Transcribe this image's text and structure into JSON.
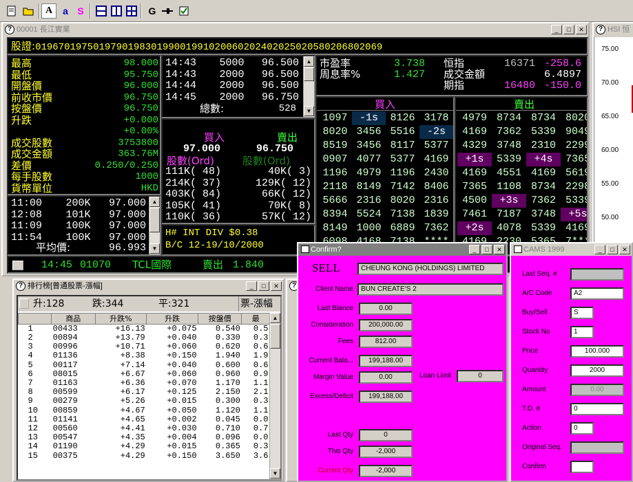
{
  "toolbar": {
    "buttons": [
      "new-icon",
      "open-icon",
      "A",
      "a",
      "S",
      "layout1-icon",
      "layout2-icon",
      "layout3-icon",
      "G",
      "pin-icon",
      "print-icon"
    ]
  },
  "quote_win": {
    "title": "00001 長江實業",
    "codes_label": "股證:",
    "codes": [
      "01967",
      "01975",
      "01979",
      "01983",
      "01990",
      "01991",
      "02006",
      "02024",
      "02025",
      "02058",
      "02068",
      "02069"
    ],
    "stats": [
      [
        "最高",
        "98.000"
      ],
      [
        "最低",
        "95.750"
      ],
      [
        "開盤價",
        "96.000"
      ],
      [
        "前收市價",
        "96.750"
      ],
      [
        "按盤價",
        "96.750"
      ],
      [
        "升跌",
        "+0.000"
      ],
      [
        "",
        "+0.00%"
      ],
      [
        "成交股數",
        "3753800"
      ],
      [
        "成交金額",
        "363.76M"
      ],
      [
        "差價",
        "0.250/0.250"
      ],
      [
        "每手股數",
        "1000"
      ],
      [
        "貨幣單位",
        "HKD"
      ]
    ],
    "ticks": [
      [
        "14:43",
        "5000",
        "96.500"
      ],
      [
        "14:43",
        "2000",
        "96.500"
      ],
      [
        "14:44",
        "2000",
        "96.500"
      ],
      [
        "14:45",
        "2000",
        "96.750"
      ]
    ],
    "total_label": "總數:",
    "total": "528",
    "bidask": {
      "bid_label": "買入",
      "ask_label": "賣出",
      "bid": "97.000",
      "ask": "96.750",
      "ord_bid_label": "股數(Ord)",
      "ord_ask_label": "股數(Ord)",
      "rows": [
        [
          "111K( 48)",
          "40K(  3)"
        ],
        [
          "214K( 37)",
          "129K( 12)"
        ],
        [
          "403K( 84)",
          "66K( 12)"
        ],
        [
          "105K( 41)",
          "70K(  8)"
        ],
        [
          "110K( 36)",
          "57K( 12)"
        ]
      ]
    },
    "trades": [
      [
        "11:00",
        "200K",
        "97.000"
      ],
      [
        "12:08",
        "101K",
        "97.000"
      ],
      [
        "11:09",
        "100K",
        "97.000"
      ],
      [
        "11:54",
        "100K",
        "97.000"
      ]
    ],
    "avg_label": "平均價:",
    "avg": "96.993",
    "info": [
      "H# INT DIV $0.38",
      "B/C 12-19/10/2000"
    ],
    "ratios": [
      [
        "市盈率",
        "3.738"
      ],
      [
        "周息率%",
        "1.427"
      ]
    ],
    "index": [
      [
        "恒指",
        "16371",
        "-258.6"
      ],
      [
        "成交金額",
        "",
        "6.4897"
      ],
      [
        "期指",
        "16480",
        "-150.0"
      ]
    ],
    "queue_bid_label": "買入",
    "queue_ask_label": "賣出",
    "queue_bid": [
      [
        "1097",
        "-1s",
        "8126",
        "3178"
      ],
      [
        "8020",
        "3456",
        "5516",
        "-2s"
      ],
      [
        "8519",
        "3456",
        "8117",
        "5377"
      ],
      [
        "0907",
        "4077",
        "5377",
        "4169"
      ],
      [
        "1196",
        "4979",
        "1196",
        "2430"
      ],
      [
        "2118",
        "8149",
        "7142",
        "8406"
      ],
      [
        "5666",
        "2316",
        "8020",
        "2316"
      ],
      [
        "8394",
        "5524",
        "7138",
        "1839"
      ],
      [
        "8149",
        "1000",
        "6889",
        "7362"
      ],
      [
        "6098",
        "4168",
        "7138",
        "****"
      ]
    ],
    "queue_ask": [
      [
        "4979",
        "8734",
        "8734",
        "8020"
      ],
      [
        "4169",
        "7362",
        "5339",
        "9049"
      ],
      [
        "4329",
        "3748",
        "2310",
        "2299"
      ],
      [
        "+1s",
        "5339",
        "+4s",
        "7365"
      ],
      [
        "4169",
        "4551",
        "4169",
        "5619"
      ],
      [
        "7365",
        "1108",
        "8734",
        "2298"
      ],
      [
        "4500",
        "+3s",
        "7362",
        "5339"
      ],
      [
        "7461",
        "7187",
        "3748",
        "+5s"
      ],
      [
        "+2s",
        "4078",
        "5339",
        "4169"
      ],
      [
        "4169",
        "2230",
        "5365",
        "7***"
      ]
    ],
    "bottom": {
      "time": "14:45",
      "code": "01070",
      "name": "TCL國際",
      "side": "賣出",
      "price": "1.840"
    }
  },
  "hsi_win": {
    "title": "HSI 恒",
    "ticks": [
      "75.00",
      "70.00",
      "65.00",
      "60.00",
      "55.00",
      "50.00"
    ]
  },
  "rank_win": {
    "title": "排行榜[普通股票-漲幅]",
    "up_label": "升:",
    "up": "128",
    "down_label": "跌:",
    "down": "344",
    "flat_label": "平:",
    "flat": "321",
    "tab": "票-漲幅",
    "headers": [
      "",
      "商品",
      "升跌%",
      "升跌",
      "按盤價",
      "最"
    ],
    "rows": [
      [
        "1",
        "00433",
        "+16.13",
        "+0.075",
        "0.540",
        "0.5"
      ],
      [
        "2",
        "00894",
        "+13.79",
        "+0.040",
        "0.330",
        "0.3"
      ],
      [
        "3",
        "00996",
        "+10.71",
        "+0.060",
        "0.620",
        "0.6"
      ],
      [
        "4",
        "01136",
        "+8.38",
        "+0.150",
        "1.940",
        "1.9"
      ],
      [
        "5",
        "00117",
        "+7.14",
        "+0.040",
        "0.600",
        "0.6"
      ],
      [
        "6",
        "08015",
        "+6.67",
        "+0.060",
        "0.960",
        "0.9"
      ],
      [
        "7",
        "01163",
        "+6.36",
        "+0.070",
        "1.170",
        "1.1"
      ],
      [
        "8",
        "00599",
        "+6.17",
        "+0.125",
        "2.150",
        "2.1"
      ],
      [
        "9",
        "00279",
        "+5.26",
        "+0.015",
        "0.300",
        "0.3"
      ],
      [
        "10",
        "00859",
        "+4.67",
        "+0.050",
        "1.120",
        "1.1"
      ],
      [
        "11",
        "01141",
        "+4.65",
        "+0.002",
        "0.045",
        "0.0"
      ],
      [
        "12",
        "00560",
        "+4.41",
        "+0.030",
        "0.710",
        "0.7"
      ],
      [
        "13",
        "00547",
        "+4.35",
        "+0.004",
        "0.096",
        "0.0"
      ],
      [
        "14",
        "01190",
        "+4.29",
        "+0.015",
        "0.365",
        "0.3"
      ],
      [
        "15",
        "00375",
        "+4.29",
        "+0.150",
        "3.650",
        "3.6"
      ]
    ]
  },
  "confirm_win": {
    "title": "Confirm?",
    "side": "SELL",
    "company": "CHEUNG KONG (HOLDINGS) LIMITED",
    "fields": [
      [
        "Client Name",
        "BUN CREATE'S 2"
      ],
      [
        "Last Blance",
        "0.00"
      ],
      [
        "Consideration",
        "200,000.00"
      ],
      [
        "Fees",
        "812.00"
      ],
      [
        "Current Bala...",
        "199,188.00"
      ],
      [
        "Margin Value",
        "0.00"
      ],
      [
        "Excess/Deficit",
        "199,188.00"
      ],
      [
        "Last Qty",
        "0"
      ],
      [
        "This Qty",
        "-2,000"
      ],
      [
        "Current Qty",
        "-2,000"
      ]
    ],
    "loan_label": "Loan Limit",
    "loan": "0"
  },
  "cams_win": {
    "title": "CAMS 1999",
    "fields": [
      [
        "Last Seq. #",
        ""
      ],
      [
        "A/C Code",
        "A2"
      ],
      [
        "Buy/Sell",
        "S"
      ],
      [
        "Stock No",
        "1"
      ],
      [
        "Price",
        "100.000"
      ],
      [
        "Quantity",
        "2000"
      ],
      [
        "Amount",
        "0.00"
      ],
      [
        "T.D. #",
        "0"
      ],
      [
        "Action",
        "0"
      ],
      [
        "Original Seq.",
        ""
      ],
      [
        "Confirm",
        ""
      ]
    ]
  }
}
